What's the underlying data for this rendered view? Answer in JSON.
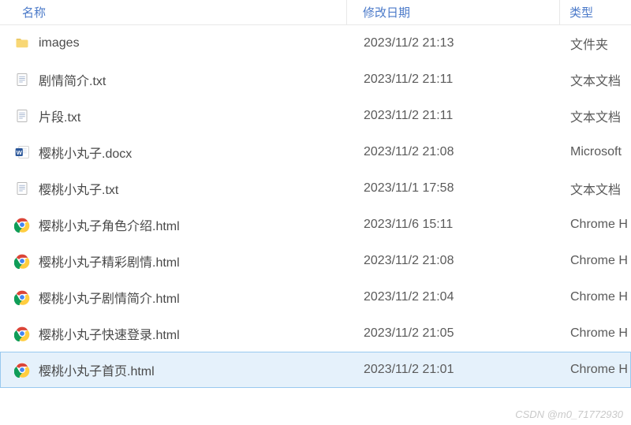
{
  "columns": {
    "name": "名称",
    "date": "修改日期",
    "type": "类型"
  },
  "rows": [
    {
      "icon": "folder",
      "name": "images",
      "date": "2023/11/2 21:13",
      "type": "文件夹",
      "selected": false
    },
    {
      "icon": "txt",
      "name": "剧情简介.txt",
      "date": "2023/11/2 21:11",
      "type": "文本文档",
      "selected": false
    },
    {
      "icon": "txt",
      "name": "片段.txt",
      "date": "2023/11/2 21:11",
      "type": "文本文档",
      "selected": false
    },
    {
      "icon": "word",
      "name": "樱桃小丸子.docx",
      "date": "2023/11/2 21:08",
      "type": "Microsoft",
      "selected": false
    },
    {
      "icon": "txt",
      "name": "樱桃小丸子.txt",
      "date": "2023/11/1 17:58",
      "type": "文本文档",
      "selected": false
    },
    {
      "icon": "chrome",
      "name": "樱桃小丸子角色介绍.html",
      "date": "2023/11/6 15:11",
      "type": "Chrome H",
      "selected": false
    },
    {
      "icon": "chrome",
      "name": "樱桃小丸子精彩剧情.html",
      "date": "2023/11/2 21:08",
      "type": "Chrome H",
      "selected": false
    },
    {
      "icon": "chrome",
      "name": "樱桃小丸子剧情简介.html",
      "date": "2023/11/2 21:04",
      "type": "Chrome H",
      "selected": false
    },
    {
      "icon": "chrome",
      "name": "樱桃小丸子快速登录.html",
      "date": "2023/11/2 21:05",
      "type": "Chrome H",
      "selected": false
    },
    {
      "icon": "chrome",
      "name": "樱桃小丸子首页.html",
      "date": "2023/11/2 21:01",
      "type": "Chrome H",
      "selected": true
    }
  ],
  "watermark": "CSDN @m0_71772930"
}
